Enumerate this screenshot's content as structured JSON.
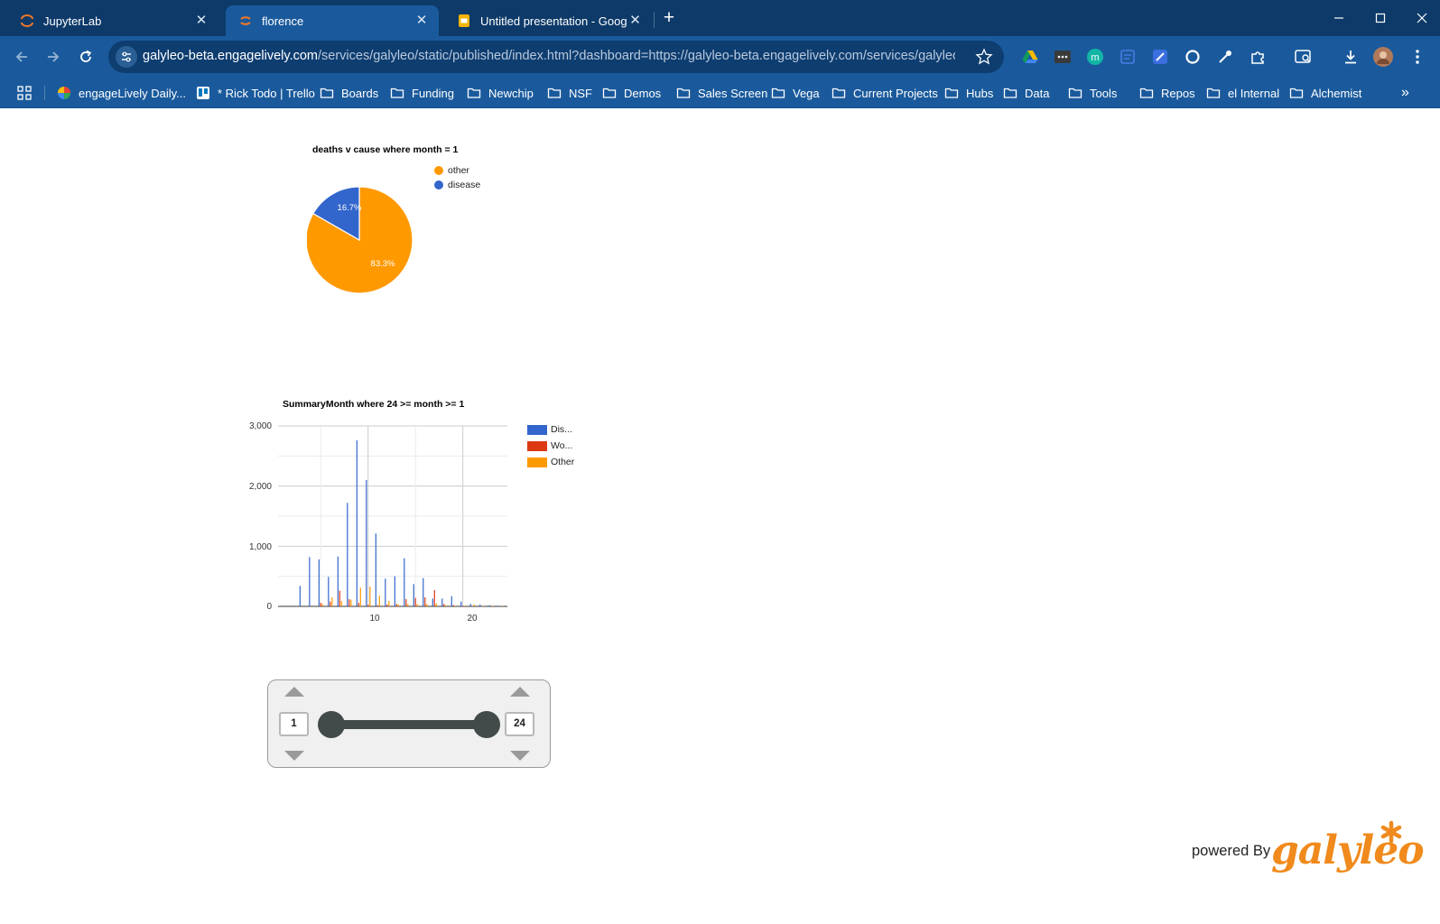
{
  "browser": {
    "tabs": [
      {
        "title": "JupyterLab",
        "icon": "jupyter-icon",
        "active": false
      },
      {
        "title": "florence",
        "icon": "galyleo-icon",
        "active": true
      },
      {
        "title": "Untitled presentation - Google",
        "icon": "google-slides-icon",
        "active": false
      }
    ],
    "url_host": "galyleo-beta.engagelively.com",
    "url_rest": "/services/galyleo/static/published/index.html?dashboard=https://galyleo-beta.engagelively.com/services/galyleo/d...",
    "bookmarks": [
      {
        "label": "engageLively  Daily...",
        "icon": "colorful-app-icon"
      },
      {
        "label": "* Rick Todo | Trello",
        "icon": "trello-icon"
      },
      {
        "label": "Boards",
        "icon": "folder-icon"
      },
      {
        "label": "Funding",
        "icon": "folder-icon"
      },
      {
        "label": "Newchip",
        "icon": "folder-icon"
      },
      {
        "label": "NSF",
        "icon": "folder-icon"
      },
      {
        "label": "Demos",
        "icon": "folder-icon"
      },
      {
        "label": "Sales Screen",
        "icon": "folder-icon"
      },
      {
        "label": "Vega",
        "icon": "folder-icon"
      },
      {
        "label": "Current Projects",
        "icon": "folder-icon"
      },
      {
        "label": "Hubs",
        "icon": "folder-icon"
      },
      {
        "label": "Data",
        "icon": "folder-icon"
      },
      {
        "label": "Tools",
        "icon": "folder-icon"
      },
      {
        "label": "Repos",
        "icon": "folder-icon"
      },
      {
        "label": "el Internal",
        "icon": "folder-icon"
      },
      {
        "label": "Alchemist",
        "icon": "folder-icon"
      }
    ],
    "colors": {
      "tabbar": "#0d3a69",
      "toolbar": "#1a5a9c"
    }
  },
  "pie": {
    "title": "deaths v cause where month = 1",
    "legend": [
      {
        "label": "other",
        "color": "#ff9900"
      },
      {
        "label": "disease",
        "color": "#3366cc"
      }
    ],
    "labels": [
      "83.3%",
      "16.7%"
    ]
  },
  "bar": {
    "title": "SummaryMonth where 24 >= month >= 1",
    "legend": [
      {
        "label": "Dis...",
        "color": "#3366cc"
      },
      {
        "label": "Wo...",
        "color": "#dc3912"
      },
      {
        "label": "Other",
        "color": "#ff9900"
      }
    ],
    "y_ticks": [
      "3,000",
      "2,000",
      "1,000",
      "0"
    ],
    "x_ticks": [
      "10",
      "20"
    ]
  },
  "chart_data": [
    {
      "type": "pie",
      "title": "deaths v cause where month = 1",
      "categories": [
        "other",
        "disease"
      ],
      "values": [
        83.3,
        16.7
      ],
      "legend": "right"
    },
    {
      "type": "bar",
      "title": "SummaryMonth where 24 >= month >= 1",
      "x": [
        1,
        2,
        3,
        4,
        5,
        6,
        7,
        8,
        9,
        10,
        11,
        12,
        13,
        14,
        15,
        16,
        17,
        18,
        19,
        20,
        21,
        22,
        23,
        24
      ],
      "series": [
        {
          "name": "Dis...",
          "values": [
            0,
            0,
            340,
            820,
            780,
            490,
            830,
            1720,
            2760,
            2100,
            1210,
            460,
            500,
            800,
            370,
            470,
            130,
            130,
            170,
            80,
            40,
            30,
            20,
            10
          ]
        },
        {
          "name": "Wo...",
          "values": [
            0,
            0,
            0,
            0,
            60,
            80,
            260,
            120,
            60,
            30,
            20,
            30,
            40,
            120,
            140,
            150,
            270,
            40,
            20,
            10,
            5,
            5,
            5,
            5
          ]
        },
        {
          "name": "Other",
          "values": [
            0,
            0,
            0,
            0,
            40,
            150,
            90,
            110,
            310,
            330,
            180,
            90,
            30,
            40,
            40,
            40,
            50,
            20,
            10,
            10,
            30,
            10,
            10,
            5
          ]
        }
      ],
      "ylim": [
        0,
        3000
      ],
      "y_ticks": [
        0,
        1000,
        2000,
        3000
      ],
      "x_ticks": [
        10,
        20
      ],
      "grid": true,
      "legend": "right"
    }
  ],
  "range_slider": {
    "min": "1",
    "max": "24"
  },
  "footer": {
    "powered_text": "powered By",
    "brand": "galyleo"
  }
}
